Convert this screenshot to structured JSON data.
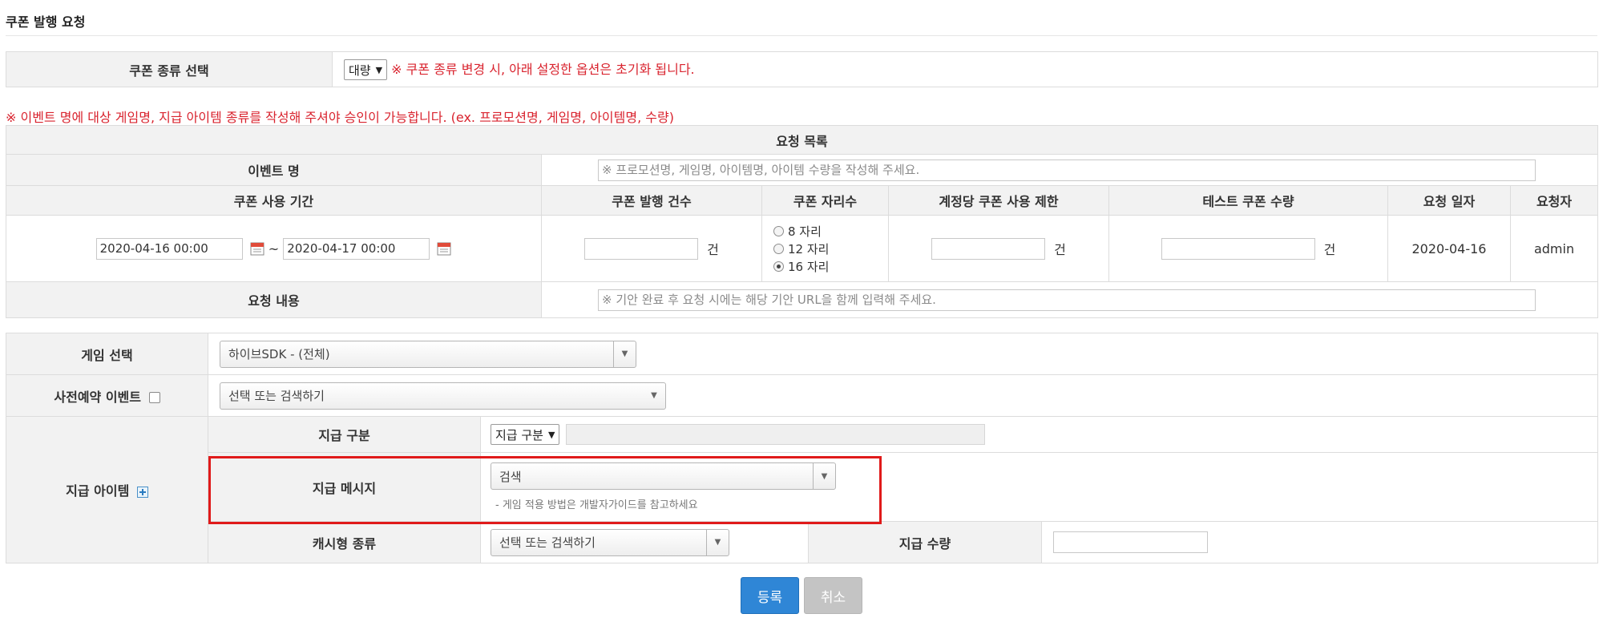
{
  "page": {
    "title": "쿠폰 발행 요청"
  },
  "coupon_type": {
    "label": "쿠폰 종류 선택",
    "selected": "대량",
    "warning": "※ 쿠폰 종류 변경 시, 아래 설정한 옵션은 초기화 됩니다."
  },
  "notice": "※ 이벤트 명에 대상 게임명, 지급 아이템 종류를 작성해 주셔야 승인이 가능합니다. (ex. 프로모션명, 게임명, 아이템명, 수량)",
  "request": {
    "list_title": "요청 목록",
    "event_name_label": "이벤트 명",
    "event_name_placeholder": "※ 프로모션명, 게임명, 아이템명, 아이템 수량을 작성해 주세요.",
    "headers": {
      "period": "쿠폰 사용 기간",
      "count": "쿠폰 발행 건수",
      "digits": "쿠폰 자리수",
      "limit": "계정당 쿠폰 사용 제한",
      "test_qty": "테스트 쿠폰 수량",
      "date": "요청 일자",
      "requester": "요청자"
    },
    "start_date": "2020-04-16 00:00",
    "separator": "~",
    "end_date": "2020-04-17 00:00",
    "unit": "건",
    "digit_options": [
      "8 자리",
      "12 자리",
      "16 자리"
    ],
    "digit_selected_index": 2,
    "request_date": "2020-04-16",
    "requester": "admin",
    "content_label": "요청 내용",
    "content_placeholder": "※ 기안 완료 후 요청 시에는 해당 기안 URL을 함께 입력해 주세요."
  },
  "settings": {
    "game_label": "게임 선택",
    "game_selected": "하이브SDK - (전체)",
    "preorder_label": "사전예약 이벤트",
    "preorder_placeholder": "선택 또는 검색하기",
    "item_label": "지급 아이템",
    "pay_type_label": "지급 구분",
    "pay_type_selected": "지급 구분",
    "pay_message_label": "지급 메시지",
    "pay_message_selected": "검색",
    "pay_message_hint": "- 게임 적용 방법은 개발자가이드를 참고하세요",
    "cash_type_label": "캐시형 종류",
    "cash_type_placeholder": "선택 또는 검색하기",
    "pay_qty_label": "지급 수량"
  },
  "buttons": {
    "submit": "등록",
    "cancel": "취소"
  },
  "colors": {
    "warning": "#d9232e",
    "highlight": "#e01a1a",
    "primary": "#2f86d6"
  }
}
